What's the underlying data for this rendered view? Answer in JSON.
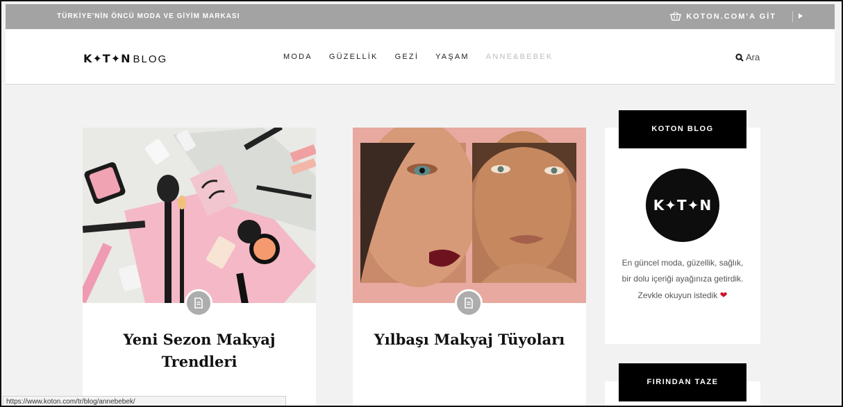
{
  "topbar": {
    "tagline": "TÜRKİYE'NİN ÖNCÜ MODA VE GİYİM MARKASI",
    "goto_label": "KOTON.COM'A GİT"
  },
  "header": {
    "logo_brand": "K✦T✦N",
    "logo_suffix": "BLOG",
    "nav": [
      "MODA",
      "GÜZELLİK",
      "GEZİ",
      "YAŞAM",
      "ANNE&BEBEK"
    ],
    "search_label": "Ara"
  },
  "posts": [
    {
      "title": "Yeni Sezon Makyaj Trendleri"
    },
    {
      "title": "Yılbaşı Makyaj Tüyoları"
    }
  ],
  "sidebar": {
    "heading": "KOTON BLOG",
    "logo_text": "K✦T✦N",
    "description": "En güncel moda, güzellik, sağlık, bir dolu içeriği ayağınıza getirdik. Zevkle okuyun istedik",
    "heading2": "FIRINDAN TAZE"
  },
  "status_url": "https://www.koton.com/tr/blog/annebebek/",
  "colors": {
    "topbar": "#a3a3a3",
    "accent_heart": "#d0102a",
    "faded_nav": "#bdbdbd"
  }
}
